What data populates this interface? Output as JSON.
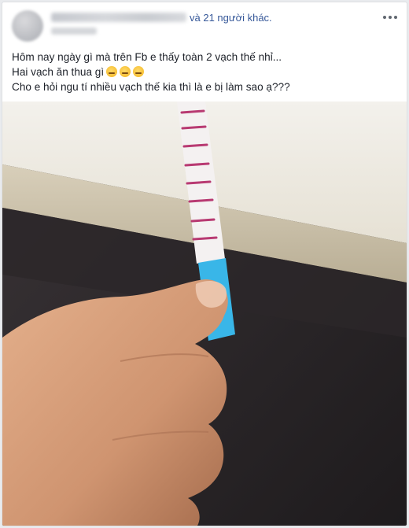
{
  "post": {
    "reactions_suffix": "và 21 người khác.",
    "lines": [
      "Hôm nay ngày gì mà trên Fb e thấy toàn 2 vạch thế nhỉ...",
      "Hai vạch ăn thua gì",
      "Cho e hỏi ngu tí nhiều vạch thế kia thì là e bị làm sao ạ???"
    ],
    "emoji_count": 3,
    "more_icon": "more-horizontal-icon"
  },
  "photo": {
    "subject": "test-strip-in-hand",
    "colors": {
      "counter": "#e8e3d7",
      "tabletop_edge": "#c9c1ad",
      "strip": "#f4f1f1",
      "marks": "#b83a72",
      "strip_tip": "#39b6e8",
      "skin": "#d9a27f",
      "background_dark": "#2a2628"
    }
  }
}
